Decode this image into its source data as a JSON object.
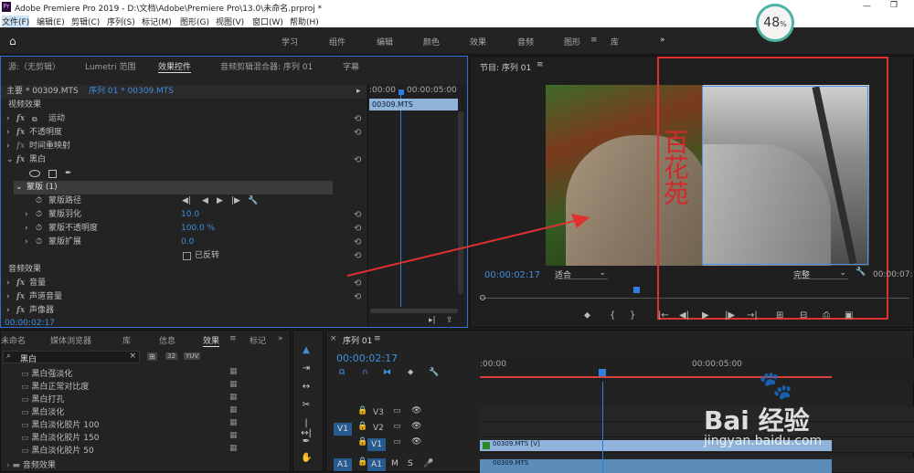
{
  "title_bar": {
    "title": "Adobe Premiere Pro 2019 - D:\\文档\\Adobe\\Premiere Pro\\13.0\\未命名.prproj *"
  },
  "menu": [
    "文件(F)",
    "编辑(E)",
    "剪辑(C)",
    "序列(S)",
    "标记(M)",
    "图形(G)",
    "视图(V)",
    "窗口(W)",
    "帮助(H)"
  ],
  "workspaces": [
    "学习",
    "组件",
    "编辑",
    "颜色",
    "效果",
    "音频",
    "图形",
    "库"
  ],
  "workspace_active": "图形",
  "overlay_percent": "48",
  "overlay_unit": "%",
  "source_panel": {
    "tabs": [
      "源:（无剪辑）",
      "Lumetri 范围",
      "效果控件",
      "音频剪辑混合器: 序列 01",
      "字幕"
    ],
    "active_tab": "效果控件",
    "master": "主要 * 00309.MTS",
    "sequence": "序列 01 * 00309.MTS",
    "time_start": ":00:00",
    "time_end": "00:00:05:00",
    "clip_name": "00309.MTS",
    "video_effects": "视频效果",
    "effects": [
      "运动",
      "不透明度",
      "时间重映射",
      "黑白"
    ],
    "mask": "蒙版 (1)",
    "mask_path": "蒙版路径",
    "mask_props": [
      {
        "name": "蒙版羽化",
        "value": "10.0"
      },
      {
        "name": "蒙版不透明度",
        "value": "100.0 %"
      },
      {
        "name": "蒙版扩展",
        "value": "0.0"
      }
    ],
    "invert": "已反转",
    "audio_effects": "音频效果",
    "audio": [
      "音量",
      "声道音量",
      "声像器"
    ],
    "timecode": "00:00:02:17"
  },
  "program_panel": {
    "title": "节目: 序列 01",
    "timecode": "00:00:02:17",
    "fit": "适合",
    "quality": "完整",
    "end_time": "00:00:07:"
  },
  "project_panel": {
    "tabs": [
      "未命名",
      "媒体浏览器",
      "库",
      "信息",
      "效果",
      "标记"
    ],
    "active_tab": "效果",
    "search": "黑白",
    "items": [
      "黑白强淡化",
      "黑白正常对比度",
      "黑白打孔",
      "黑白淡化",
      "黑白淡化胶片 100",
      "黑白淡化胶片 150",
      "黑白淡化胶片 50"
    ],
    "folder": "音频效果"
  },
  "timeline": {
    "tab": "序列 01",
    "timecode": "00:00:02:17",
    "ruler_start": ":00:00",
    "ruler_mid": "00:00:05:00",
    "tracks": [
      {
        "target": "",
        "name": "V3"
      },
      {
        "target": "V1",
        "name": "V2"
      },
      {
        "target": "",
        "name": "V1"
      },
      {
        "target": "A1",
        "name": "A1"
      }
    ],
    "clip": "00309.MTS [V]",
    "clip_audio": "00309.MTS"
  },
  "watermark": {
    "brand": "Bai 经验",
    "url": "jingyan.baidu.com"
  },
  "colors": {
    "accent": "#3f8ee0",
    "annotation": "#e03030",
    "playhead": "#2f7fe0",
    "clip": "#8fb3d9"
  }
}
